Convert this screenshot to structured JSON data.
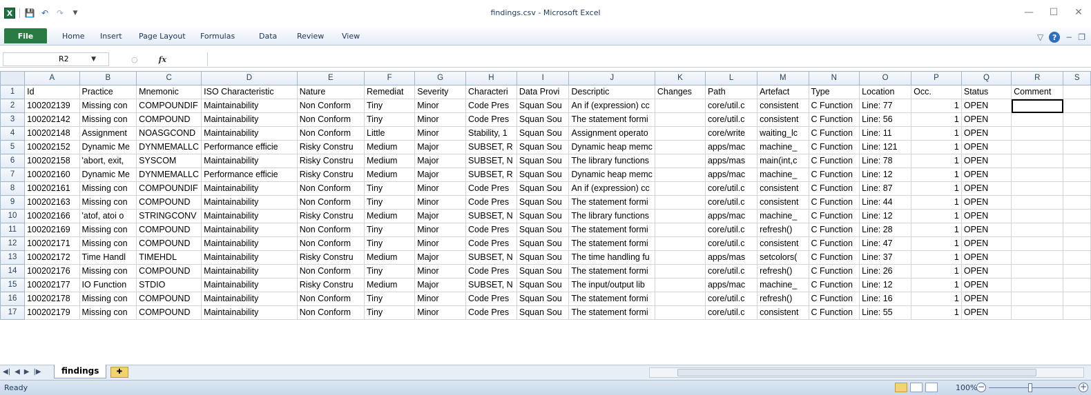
{
  "window": {
    "title": "findings.csv - Microsoft Excel"
  },
  "ribbon": {
    "tabs": [
      "File",
      "Home",
      "Insert",
      "Page Layout",
      "Formulas",
      "Data",
      "Review",
      "View"
    ]
  },
  "formula_bar": {
    "name_box": "R2",
    "fx": "fx",
    "value": ""
  },
  "columns": [
    "A",
    "B",
    "C",
    "D",
    "E",
    "F",
    "G",
    "H",
    "I",
    "J",
    "K",
    "L",
    "M",
    "N",
    "O",
    "P",
    "Q",
    "R",
    "S"
  ],
  "rows": [
    [
      "1",
      "Id",
      "Practice",
      "Mnemonic",
      "ISO Characteristic",
      "Nature",
      "Remediat",
      "Severity",
      "Characteri",
      "Data Provi",
      "Descriptic",
      "Changes",
      "Path",
      "Artefact",
      "Type",
      "Location",
      "Occ.",
      "Status",
      "Comment",
      ""
    ],
    [
      "2",
      "100202139",
      "Missing con",
      "COMPOUNDIF",
      "Maintainability",
      "Non Conform",
      "Tiny",
      "Minor",
      "Code Pres",
      "Squan Sou",
      "An if (expression) cc",
      "",
      "core/util.c",
      "consistent",
      "C Function",
      "Line: 77",
      "1",
      "OPEN",
      "",
      ""
    ],
    [
      "3",
      "100202142",
      "Missing con",
      "COMPOUND",
      "Maintainability",
      "Non Conform",
      "Tiny",
      "Minor",
      "Code Pres",
      "Squan Sou",
      "The statement formi",
      "",
      "core/util.c",
      "consistent",
      "C Function",
      "Line: 56",
      "1",
      "OPEN",
      "",
      ""
    ],
    [
      "4",
      "100202148",
      "Assignment",
      "NOASGCOND",
      "Maintainability",
      "Non Conform",
      "Little",
      "Minor",
      "Stability, 1",
      "Squan Sou",
      "Assignment operato",
      "",
      "core/write",
      "waiting_lc",
      "C Function",
      "Line: 11",
      "1",
      "OPEN",
      "",
      ""
    ],
    [
      "5",
      "100202152",
      "Dynamic Me",
      "DYNMEMALLC",
      "Performance efficie",
      "Risky Constru",
      "Medium",
      "Major",
      "SUBSET, R",
      "Squan Sou",
      "Dynamic heap memc",
      "",
      "apps/mac",
      "machine_",
      "C Function",
      "Line: 121",
      "1",
      "OPEN",
      "",
      ""
    ],
    [
      "6",
      "100202158",
      "'abort, exit,",
      "SYSCOM",
      "Maintainability",
      "Risky Constru",
      "Medium",
      "Major",
      "SUBSET, N",
      "Squan Sou",
      "The library functions",
      "",
      "apps/mas",
      "main(int,c",
      "C Function",
      "Line: 78",
      "1",
      "OPEN",
      "",
      ""
    ],
    [
      "7",
      "100202160",
      "Dynamic Me",
      "DYNMEMALLC",
      "Performance efficie",
      "Risky Constru",
      "Medium",
      "Major",
      "SUBSET, R",
      "Squan Sou",
      "Dynamic heap memc",
      "",
      "apps/mac",
      "machine_",
      "C Function",
      "Line: 12",
      "1",
      "OPEN",
      "",
      ""
    ],
    [
      "8",
      "100202161",
      "Missing con",
      "COMPOUNDIF",
      "Maintainability",
      "Non Conform",
      "Tiny",
      "Minor",
      "Code Pres",
      "Squan Sou",
      "An if (expression) cc",
      "",
      "core/util.c",
      "consistent",
      "C Function",
      "Line: 87",
      "1",
      "OPEN",
      "",
      ""
    ],
    [
      "9",
      "100202163",
      "Missing con",
      "COMPOUND",
      "Maintainability",
      "Non Conform",
      "Tiny",
      "Minor",
      "Code Pres",
      "Squan Sou",
      "The statement formi",
      "",
      "core/util.c",
      "consistent",
      "C Function",
      "Line: 44",
      "1",
      "OPEN",
      "",
      ""
    ],
    [
      "10",
      "100202166",
      "'atof, atoi o",
      "STRINGCONV",
      "Maintainability",
      "Risky Constru",
      "Medium",
      "Major",
      "SUBSET, N",
      "Squan Sou",
      "The library functions",
      "",
      "apps/mac",
      "machine_",
      "C Function",
      "Line: 12",
      "1",
      "OPEN",
      "",
      ""
    ],
    [
      "11",
      "100202169",
      "Missing con",
      "COMPOUND",
      "Maintainability",
      "Non Conform",
      "Tiny",
      "Minor",
      "Code Pres",
      "Squan Sou",
      "The statement formi",
      "",
      "core/util.c",
      "refresh()",
      "C Function",
      "Line: 28",
      "1",
      "OPEN",
      "",
      ""
    ],
    [
      "12",
      "100202171",
      "Missing con",
      "COMPOUND",
      "Maintainability",
      "Non Conform",
      "Tiny",
      "Minor",
      "Code Pres",
      "Squan Sou",
      "The statement formi",
      "",
      "core/util.c",
      "consistent",
      "C Function",
      "Line: 47",
      "1",
      "OPEN",
      "",
      ""
    ],
    [
      "13",
      "100202172",
      "Time Handl",
      "TIMEHDL",
      "Maintainability",
      "Risky Constru",
      "Medium",
      "Major",
      "SUBSET, N",
      "Squan Sou",
      "The time handling fu",
      "",
      "apps/mas",
      "setcolors(",
      "C Function",
      "Line: 37",
      "1",
      "OPEN",
      "",
      ""
    ],
    [
      "14",
      "100202176",
      "Missing con",
      "COMPOUND",
      "Maintainability",
      "Non Conform",
      "Tiny",
      "Minor",
      "Code Pres",
      "Squan Sou",
      "The statement formi",
      "",
      "core/util.c",
      "refresh()",
      "C Function",
      "Line: 26",
      "1",
      "OPEN",
      "",
      ""
    ],
    [
      "15",
      "100202177",
      "IO Function",
      "STDIO",
      "Maintainability",
      "Risky Constru",
      "Medium",
      "Major",
      "SUBSET, N",
      "Squan Sou",
      "The input/output lib",
      "",
      "apps/mac",
      "machine_",
      "C Function",
      "Line: 12",
      "1",
      "OPEN",
      "",
      ""
    ],
    [
      "16",
      "100202178",
      "Missing con",
      "COMPOUND",
      "Maintainability",
      "Non Conform",
      "Tiny",
      "Minor",
      "Code Pres",
      "Squan Sou",
      "The statement formi",
      "",
      "core/util.c",
      "refresh()",
      "C Function",
      "Line: 16",
      "1",
      "OPEN",
      "",
      ""
    ],
    [
      "17",
      "100202179",
      "Missing con",
      "COMPOUND",
      "Maintainability",
      "Non Conform",
      "Tiny",
      "Minor",
      "Code Pres",
      "Squan Sou",
      "The statement formi",
      "",
      "core/util.c",
      "consistent",
      "C Function",
      "Line: 55",
      "1",
      "OPEN",
      "",
      ""
    ]
  ],
  "sheet_tabs": {
    "active": "findings"
  },
  "status": {
    "text": "Ready",
    "zoom": "100%"
  },
  "icons": {
    "app": "excel-icon",
    "save": "save-icon",
    "undo": "undo-icon",
    "redo": "redo-icon",
    "help": "help-icon",
    "minimize": "minimize-icon",
    "maximize": "maximize-icon",
    "close": "close-icon"
  },
  "colors": {
    "file_tab": "#2a7a43",
    "accent": "#1e395b"
  }
}
